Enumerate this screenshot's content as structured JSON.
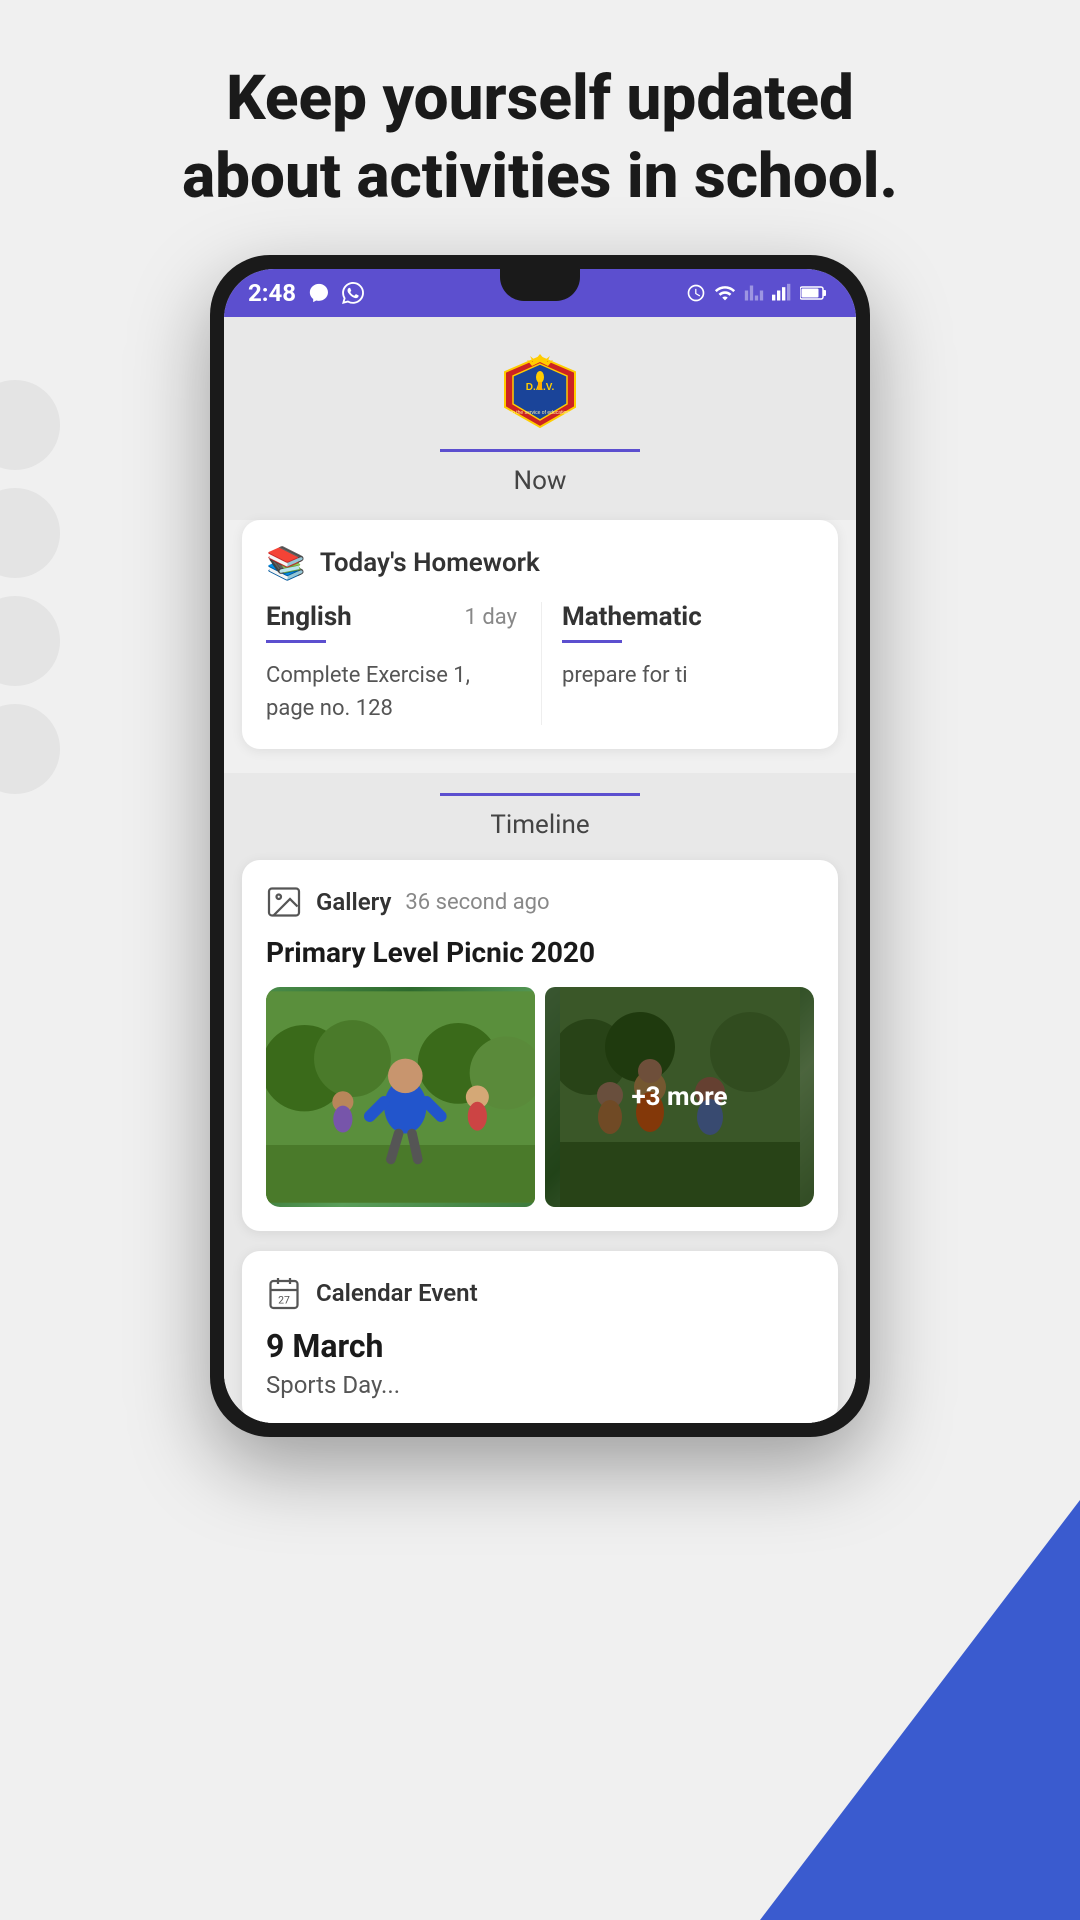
{
  "header": {
    "title_line1": "Keep yourself updated",
    "title_line2": "about activities in school."
  },
  "status_bar": {
    "time": "2:48",
    "icons": [
      "messenger",
      "whatsapp",
      "alarm",
      "wifi",
      "signal",
      "battery"
    ]
  },
  "school": {
    "name": "D.A.V.",
    "tagline": "in the service of education",
    "tab": "Now"
  },
  "homework": {
    "section_title": "Today's Homework",
    "subjects": [
      {
        "name": "English",
        "days": "1 day",
        "underline": true,
        "description": "Complete Exercise 1, page no. 128"
      },
      {
        "name": "Mathematic",
        "days": "",
        "underline": true,
        "description": "prepare for ti"
      }
    ]
  },
  "timeline": {
    "tab": "Timeline",
    "cards": [
      {
        "type": "Gallery",
        "time": "36 second ago",
        "title": "Primary Level Picnic 2020",
        "images_count": 2,
        "more": "+3 more"
      },
      {
        "type": "Calendar Event",
        "date": "9 March",
        "description": "Sports Day..."
      }
    ]
  },
  "icons": {
    "book": "📚",
    "gallery": "🖼",
    "calendar": "📅"
  }
}
